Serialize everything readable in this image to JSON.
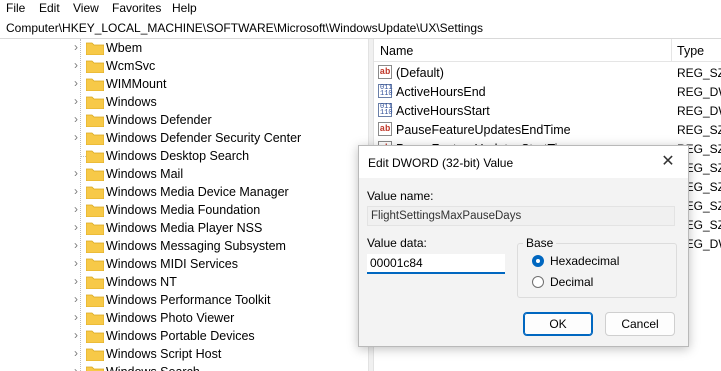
{
  "menu": [
    "File",
    "Edit",
    "View",
    "Favorites",
    "Help"
  ],
  "address": "Computer\\HKEY_LOCAL_MACHINE\\SOFTWARE\\Microsoft\\WindowsUpdate\\UX\\Settings",
  "tree": {
    "items": [
      {
        "label": "Wbem",
        "expandable": true
      },
      {
        "label": "WcmSvc",
        "expandable": true
      },
      {
        "label": "WIMMount",
        "expandable": true
      },
      {
        "label": "Windows",
        "expandable": true
      },
      {
        "label": "Windows Defender",
        "expandable": true
      },
      {
        "label": "Windows Defender Security Center",
        "expandable": true
      },
      {
        "label": "Windows Desktop Search",
        "expandable": false
      },
      {
        "label": "Windows Mail",
        "expandable": true
      },
      {
        "label": "Windows Media Device Manager",
        "expandable": true
      },
      {
        "label": "Windows Media Foundation",
        "expandable": true
      },
      {
        "label": "Windows Media Player NSS",
        "expandable": true
      },
      {
        "label": "Windows Messaging Subsystem",
        "expandable": true
      },
      {
        "label": "Windows MIDI Services",
        "expandable": true
      },
      {
        "label": "Windows NT",
        "expandable": true
      },
      {
        "label": "Windows Performance Toolkit",
        "expandable": true
      },
      {
        "label": "Windows Photo Viewer",
        "expandable": true
      },
      {
        "label": "Windows Portable Devices",
        "expandable": true
      },
      {
        "label": "Windows Script Host",
        "expandable": true
      },
      {
        "label": "Windows Search",
        "expandable": true
      }
    ]
  },
  "list": {
    "headers": {
      "name": "Name",
      "type": "Type"
    },
    "rows": [
      {
        "icon": "string-value-icon",
        "name": "(Default)",
        "type": "REG_SZ"
      },
      {
        "icon": "binary-value-icon",
        "name": "ActiveHoursEnd",
        "type": "REG_DW"
      },
      {
        "icon": "binary-value-icon",
        "name": "ActiveHoursStart",
        "type": "REG_DW"
      },
      {
        "icon": "string-value-icon",
        "name": "PauseFeatureUpdatesEndTime",
        "type": "REG_SZ"
      },
      {
        "icon": "string-value-icon",
        "name": "PauseFeatureUpdatesStartTime",
        "type": "REG_SZ"
      },
      {
        "icon": "",
        "name": "",
        "type": "REG_SZ"
      },
      {
        "icon": "",
        "name": "",
        "type": "REG_SZ"
      },
      {
        "icon": "",
        "name": "",
        "type": "REG_SZ"
      },
      {
        "icon": "",
        "name": "",
        "type": "REG_SZ"
      },
      {
        "icon": "",
        "name": "",
        "type": "REG_DW"
      }
    ]
  },
  "dialog": {
    "title": "Edit DWORD (32-bit) Value",
    "value_name_label": "Value name:",
    "value_name": "FlightSettingsMaxPauseDays",
    "value_data_label": "Value data:",
    "value_data": "00001c84",
    "base_label": "Base",
    "base_options": [
      {
        "label": "Hexadecimal",
        "selected": true
      },
      {
        "label": "Decimal",
        "selected": false
      }
    ],
    "ok_label": "OK",
    "cancel_label": "Cancel",
    "close_glyph": "✕"
  },
  "colors": {
    "accent": "#0067c0",
    "folder": "#f7c948"
  }
}
